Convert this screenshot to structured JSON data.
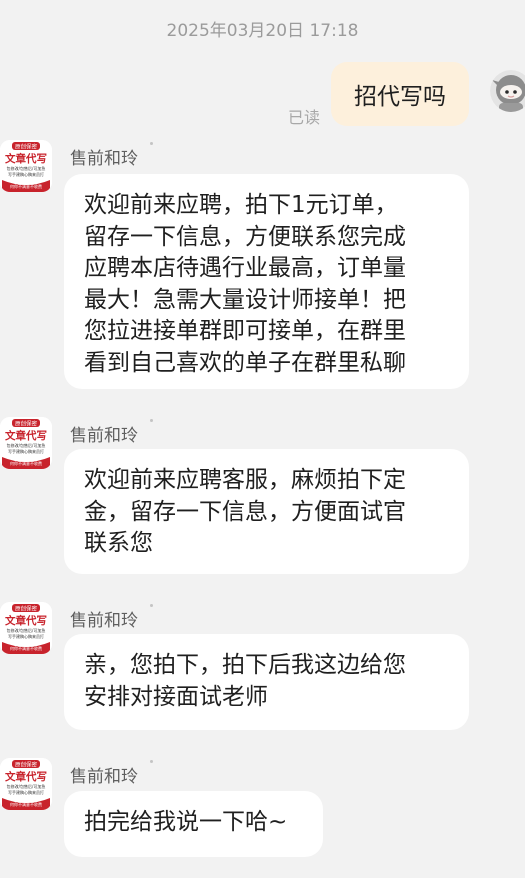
{
  "timestamp": "2025年03月20日 17:18",
  "outgoing": {
    "text": "招代写吗",
    "read_status": "已读"
  },
  "sender": {
    "name": "售前和玲",
    "avatar_text": {
      "top": "原创保密",
      "main": "文章代写",
      "line1": "包修改/包售后/可加急",
      "line2": "写手建稿心稿来员打",
      "bottom": "何你不满意不收费"
    }
  },
  "messages": [
    {
      "lines": [
        "欢迎前来应聘，拍下1元订单，",
        "留存一下信息，方便联系您完成",
        "应聘本店待遇行业最高，订单量",
        "最大！急需大量设计师接单！把",
        "您拉进接单群即可接单，在群里",
        "看到自己喜欢的单子在群里私聊"
      ]
    },
    {
      "lines": [
        "欢迎前来应聘客服，麻烦拍下定",
        "金，留存一下信息，方便面试官",
        "联系您"
      ]
    },
    {
      "lines": [
        "亲，您拍下，拍下后我这边给您",
        "安排对接面试老师"
      ]
    },
    {
      "lines": [
        "拍完给我说一下哈~"
      ]
    }
  ],
  "colors": {
    "background": "#f2f2f2",
    "outgoing_bubble": "#fdf0dc",
    "incoming_bubble": "#ffffff",
    "avatar_red": "#c8232c"
  }
}
